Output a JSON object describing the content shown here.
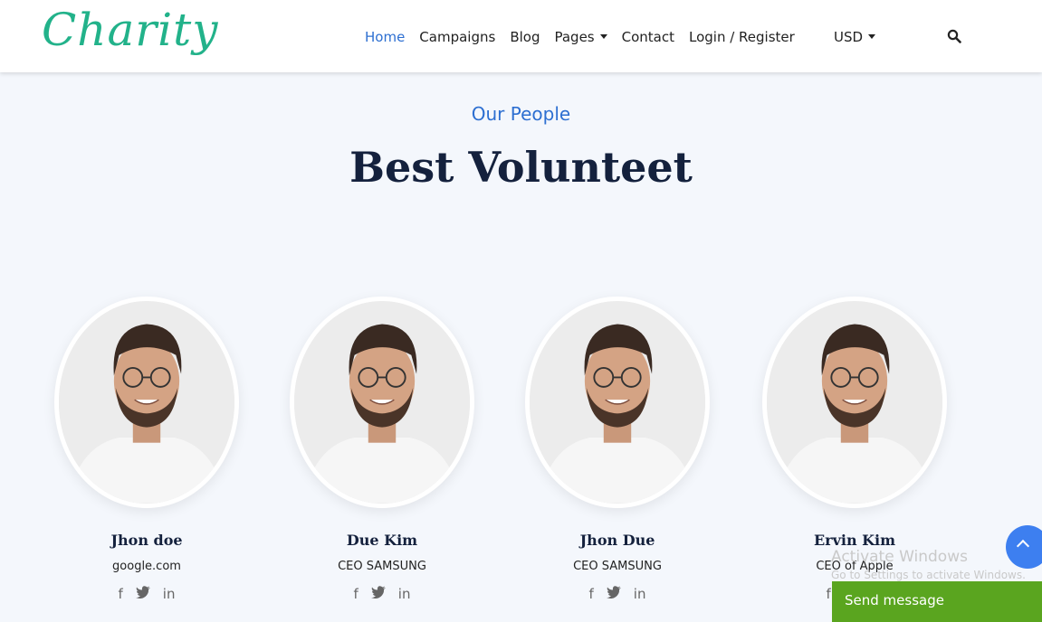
{
  "brand": {
    "logo": "Charity",
    "color": "#22b28a"
  },
  "nav": {
    "items": [
      {
        "label": "Home",
        "active": true
      },
      {
        "label": "Campaigns",
        "active": false
      },
      {
        "label": "Blog",
        "active": false
      },
      {
        "label": "Pages",
        "active": false,
        "dropdown": true
      },
      {
        "label": "Contact",
        "active": false
      },
      {
        "label": "Login / Register",
        "active": false
      }
    ],
    "currency": "USD",
    "search_icon": "search-icon"
  },
  "section": {
    "eyebrow": "Our People",
    "title": "Best Volunteet"
  },
  "volunteers": [
    {
      "name": "Jhon doe",
      "role": "google.com"
    },
    {
      "name": "Due Kim",
      "role": "CEO SAMSUNG"
    },
    {
      "name": "Jhon Due",
      "role": "CEO SAMSUNG"
    },
    {
      "name": "Ervin Kim",
      "role": "CEO of Apple"
    }
  ],
  "social_icons": [
    "facebook-icon",
    "twitter-icon",
    "linkedin-icon"
  ],
  "windows_notice": {
    "title": "Activate Windows",
    "subtitle": "Go to Settings to activate Windows."
  },
  "chat": {
    "label": "Send message",
    "color": "#5aa51f"
  },
  "colors": {
    "accent": "#2d6fd1",
    "heading": "#14213d",
    "background": "#f4f7fc",
    "scroll_button": "#3d7ff0"
  }
}
